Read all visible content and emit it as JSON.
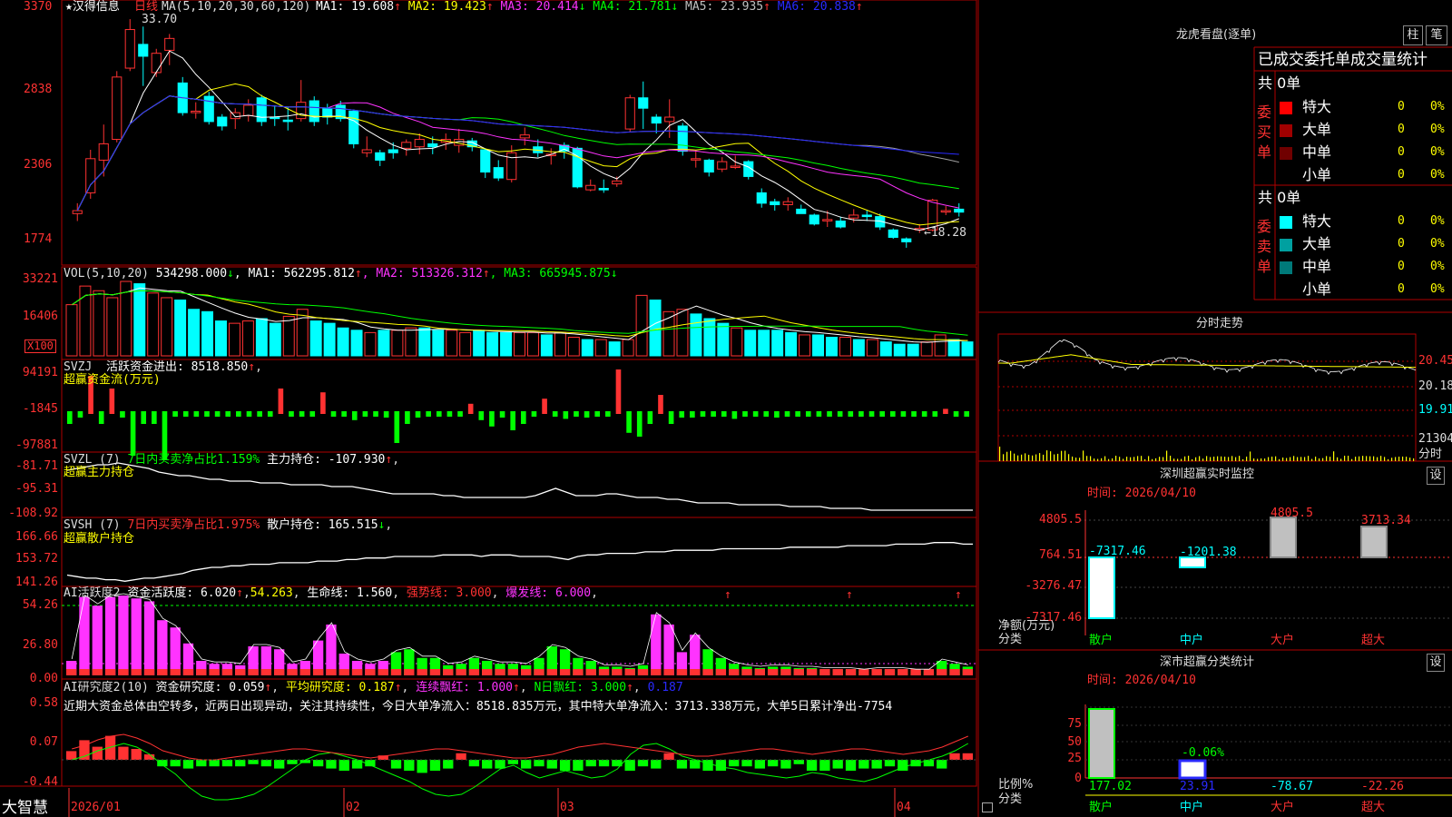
{
  "stock_name": "汉得信息",
  "period_label": "日线",
  "brand": "大智慧",
  "colors": {
    "up": "#ff3232",
    "down": "#00ffff",
    "ma1": "#ffffff",
    "ma2": "#ffff00",
    "ma3": "#ff33ff",
    "ma4": "#00ff00",
    "ma5": "#a0a0a0",
    "ma6": "#2a2aff",
    "grid": "#b00000"
  },
  "main_panel": {
    "ma_title": "MA(5,10,20,30,60,120)",
    "ma_items": [
      {
        "label": "MA1: 19.608",
        "arrow": "↑",
        "color": "#ffffff"
      },
      {
        "label": "MA2: 19.423",
        "arrow": "↑",
        "color": "#ffff00"
      },
      {
        "label": "MA3: 20.414",
        "arrow": "↓",
        "color": "#ff33ff"
      },
      {
        "label": "MA4: 21.781",
        "arrow": "↓",
        "color": "#00ff00"
      },
      {
        "label": "MA5: 23.935",
        "arrow": "↑",
        "color": "#c0c0c0"
      },
      {
        "label": "MA6: 20.838",
        "arrow": "↑",
        "color": "#2a2aff"
      }
    ],
    "y_ticks": [
      "3370",
      "2838",
      "2306",
      "1774"
    ],
    "high_label": "33.70",
    "low_label": "←18.28",
    "candles": [
      {
        "o": 20.6,
        "c": 20.8,
        "h": 21.3,
        "l": 20.1
      },
      {
        "o": 22.0,
        "c": 24.3,
        "h": 24.9,
        "l": 21.6
      },
      {
        "o": 24.2,
        "c": 25.3,
        "h": 26.6,
        "l": 23.1
      },
      {
        "o": 25.6,
        "c": 29.8,
        "h": 30.2,
        "l": 25.4
      },
      {
        "o": 30.4,
        "c": 33.0,
        "h": 33.7,
        "l": 30.2
      },
      {
        "o": 32.0,
        "c": 31.2,
        "h": 33.2,
        "l": 29.2
      },
      {
        "o": 30.1,
        "c": 31.4,
        "h": 31.7,
        "l": 29.8
      },
      {
        "o": 31.6,
        "c": 32.4,
        "h": 32.7,
        "l": 30.6
      },
      {
        "o": 29.4,
        "c": 27.4,
        "h": 29.8,
        "l": 27.2
      },
      {
        "o": 27.4,
        "c": 27.5,
        "h": 28.1,
        "l": 27.0
      },
      {
        "o": 28.5,
        "c": 26.8,
        "h": 28.8,
        "l": 26.6
      },
      {
        "o": 27.1,
        "c": 26.5,
        "h": 27.3,
        "l": 26.2
      },
      {
        "o": 27.0,
        "c": 27.4,
        "h": 27.7,
        "l": 26.3
      },
      {
        "o": 27.2,
        "c": 27.9,
        "h": 28.3,
        "l": 26.8
      },
      {
        "o": 28.4,
        "c": 26.8,
        "h": 28.6,
        "l": 26.5
      },
      {
        "o": 27.1,
        "c": 27.0,
        "h": 27.9,
        "l": 26.5
      },
      {
        "o": 26.9,
        "c": 26.8,
        "h": 27.8,
        "l": 26.2
      },
      {
        "o": 27.0,
        "c": 28.1,
        "h": 29.6,
        "l": 26.8
      },
      {
        "o": 28.2,
        "c": 26.8,
        "h": 28.5,
        "l": 26.5
      },
      {
        "o": 27.7,
        "c": 27.1,
        "h": 28.0,
        "l": 26.6
      },
      {
        "o": 27.9,
        "c": 27.0,
        "h": 28.2,
        "l": 26.8
      },
      {
        "o": 27.5,
        "c": 25.3,
        "h": 27.6,
        "l": 25.0
      },
      {
        "o": 24.7,
        "c": 24.9,
        "h": 25.8,
        "l": 24.4
      },
      {
        "o": 24.7,
        "c": 24.2,
        "h": 24.9,
        "l": 23.8
      },
      {
        "o": 24.9,
        "c": 24.7,
        "h": 25.4,
        "l": 24.3
      },
      {
        "o": 25.0,
        "c": 25.4,
        "h": 25.6,
        "l": 24.5
      },
      {
        "o": 25.1,
        "c": 25.6,
        "h": 26.0,
        "l": 24.6
      },
      {
        "o": 25.3,
        "c": 25.1,
        "h": 25.8,
        "l": 24.6
      },
      {
        "o": 25.4,
        "c": 25.6,
        "h": 26.0,
        "l": 24.9
      },
      {
        "o": 25.2,
        "c": 25.6,
        "h": 26.3,
        "l": 24.7
      },
      {
        "o": 25.5,
        "c": 25.1,
        "h": 25.7,
        "l": 24.8
      },
      {
        "o": 24.9,
        "c": 23.4,
        "h": 25.0,
        "l": 23.0
      },
      {
        "o": 23.7,
        "c": 23.0,
        "h": 24.2,
        "l": 22.8
      },
      {
        "o": 22.9,
        "c": 24.7,
        "h": 25.2,
        "l": 22.7
      },
      {
        "o": 25.7,
        "c": 25.9,
        "h": 26.4,
        "l": 25.2
      },
      {
        "o": 25.1,
        "c": 24.7,
        "h": 25.6,
        "l": 24.4
      },
      {
        "o": 24.5,
        "c": 24.6,
        "h": 25.0,
        "l": 23.9
      },
      {
        "o": 25.2,
        "c": 24.8,
        "h": 25.4,
        "l": 24.3
      },
      {
        "o": 25.0,
        "c": 22.4,
        "h": 25.1,
        "l": 22.3
      },
      {
        "o": 22.2,
        "c": 22.5,
        "h": 22.9,
        "l": 22.1
      },
      {
        "o": 22.3,
        "c": 22.2,
        "h": 22.9,
        "l": 22.0
      },
      {
        "o": 22.6,
        "c": 22.8,
        "h": 23.1,
        "l": 22.4
      },
      {
        "o": 26.3,
        "c": 28.4,
        "h": 28.6,
        "l": 26.1
      },
      {
        "o": 28.4,
        "c": 27.7,
        "h": 29.5,
        "l": 26.3
      },
      {
        "o": 27.1,
        "c": 26.7,
        "h": 27.3,
        "l": 26.0
      },
      {
        "o": 26.8,
        "c": 27.1,
        "h": 28.3,
        "l": 25.7
      },
      {
        "o": 26.5,
        "c": 24.8,
        "h": 26.7,
        "l": 24.5
      },
      {
        "o": 24.3,
        "c": 24.3,
        "h": 24.9,
        "l": 23.7
      },
      {
        "o": 24.2,
        "c": 23.4,
        "h": 24.3,
        "l": 23.1
      },
      {
        "o": 23.6,
        "c": 24.1,
        "h": 24.4,
        "l": 23.4
      },
      {
        "o": 23.8,
        "c": 23.8,
        "h": 24.5,
        "l": 23.6
      },
      {
        "o": 24.1,
        "c": 23.1,
        "h": 24.2,
        "l": 22.9
      },
      {
        "o": 22.0,
        "c": 21.3,
        "h": 22.3,
        "l": 21.0
      },
      {
        "o": 21.4,
        "c": 21.2,
        "h": 21.6,
        "l": 20.8
      },
      {
        "o": 21.2,
        "c": 21.4,
        "h": 21.7,
        "l": 20.8
      },
      {
        "o": 20.9,
        "c": 20.6,
        "h": 21.2,
        "l": 20.6
      },
      {
        "o": 20.5,
        "c": 19.9,
        "h": 20.6,
        "l": 19.8
      },
      {
        "o": 20.2,
        "c": 20.2,
        "h": 20.8,
        "l": 19.7
      },
      {
        "o": 20.1,
        "c": 19.7,
        "h": 20.4,
        "l": 19.6
      },
      {
        "o": 20.3,
        "c": 20.5,
        "h": 20.9,
        "l": 20.0
      },
      {
        "o": 20.5,
        "c": 20.4,
        "h": 20.8,
        "l": 20.1
      },
      {
        "o": 20.4,
        "c": 19.7,
        "h": 20.6,
        "l": 19.5
      },
      {
        "o": 19.5,
        "c": 19.0,
        "h": 19.6,
        "l": 18.9
      },
      {
        "o": 18.9,
        "c": 18.7,
        "h": 19.0,
        "l": 18.3
      },
      {
        "o": 19.5,
        "c": 19.6,
        "h": 19.9,
        "l": 19.3
      },
      {
        "o": 19.5,
        "c": 21.5,
        "h": 21.6,
        "l": 19.4
      },
      {
        "o": 20.8,
        "c": 20.8,
        "h": 21.1,
        "l": 20.5
      },
      {
        "o": 20.9,
        "c": 20.7,
        "h": 21.3,
        "l": 20.4
      }
    ]
  },
  "vol_panel": {
    "title": "VOL(5,10,20)",
    "value": "534298.000",
    "value_arrow": "↓",
    "items": [
      {
        "label": "MA1: 562295.812",
        "arrow": "↑",
        "color": "#ffffff"
      },
      {
        "label": "MA2: 513326.312",
        "arrow": "↑",
        "color": "#ff33ff"
      },
      {
        "label": "MA3: 665945.875",
        "arrow": "↓",
        "color": "#00ff00"
      }
    ],
    "y_ticks": [
      "33221",
      "16406"
    ],
    "unit": "X100",
    "bars": [
      22,
      30,
      28,
      25,
      32,
      31,
      27,
      25,
      24,
      20,
      19,
      15,
      14,
      15,
      16,
      14,
      17,
      20,
      15,
      14,
      12,
      11,
      10,
      11,
      11,
      12,
      12,
      11,
      11,
      10,
      11,
      10,
      10,
      10,
      10,
      9,
      10,
      8,
      7,
      7,
      6,
      7,
      26,
      24,
      19,
      20,
      18,
      16,
      14,
      12,
      11,
      11,
      11,
      10,
      9,
      9,
      8,
      8,
      7,
      7,
      6,
      5,
      5,
      6,
      9,
      7,
      6
    ],
    "up": [
      1,
      1,
      1,
      1,
      1,
      0,
      1,
      1,
      0,
      0,
      0,
      0,
      1,
      1,
      0,
      0,
      1,
      1,
      0,
      0,
      0,
      0,
      1,
      0,
      1,
      1,
      0,
      0,
      1,
      1,
      0,
      0,
      0,
      1,
      1,
      0,
      1,
      1,
      0,
      1,
      0,
      1,
      1,
      0,
      1,
      1,
      0,
      0,
      0,
      1,
      0,
      0,
      0,
      0,
      1,
      0,
      0,
      1,
      0,
      1,
      0,
      0,
      0,
      1,
      1,
      0,
      0
    ]
  },
  "svzj_panel": {
    "title": "SVZJ",
    "label": "活跃资金进出: 8518.850",
    "arrow": "↑",
    "sub": "超赢资金流(万元)",
    "y_ticks": [
      "94191",
      "-1845",
      "-97881"
    ],
    "bars": [
      -10,
      -5,
      30,
      -10,
      20,
      -5,
      -35,
      -10,
      -10,
      -38,
      -4,
      -3,
      -2,
      -2,
      -3,
      0,
      -4,
      -3,
      -3,
      -2,
      20,
      -3,
      -2,
      0,
      17,
      -2,
      -3,
      -7,
      -2,
      -3,
      -5,
      -25,
      -10,
      -5,
      -3,
      -2,
      -3,
      0,
      8,
      -7,
      -12,
      -5,
      -15,
      -10,
      0,
      12,
      -3,
      -6,
      -3,
      -5,
      -2,
      -3,
      35,
      -17,
      -20,
      -10,
      15,
      -10,
      -5,
      -5,
      -2,
      -4,
      -3,
      -6,
      -4,
      -3,
      -4,
      -5,
      -3,
      -2,
      -3,
      -2,
      -4,
      -3,
      -2,
      -2,
      -2,
      -2,
      -2,
      -4,
      -3,
      -3,
      -2,
      4,
      -2,
      -2
    ]
  },
  "svzl_panel": {
    "title": "SVZL (7)",
    "green_label": "7日内买卖净占比1.159%",
    "label": "主力持仓: -107.930",
    "arrow": "↑",
    "sub": "超赢主力持仓",
    "y_ticks": [
      "-81.71",
      "-95.31",
      "-108.92"
    ],
    "line": [
      -86,
      -85,
      -84,
      -83,
      -83,
      -82,
      -83,
      -84,
      -85,
      -87,
      -88,
      -89,
      -89,
      -90,
      -91,
      -91,
      -92,
      -92,
      -92,
      -93,
      -93,
      -93,
      -94,
      -94,
      -94,
      -94,
      -95,
      -95,
      -95,
      -96,
      -97,
      -98,
      -99,
      -99,
      -99,
      -99,
      -99,
      -100,
      -100,
      -101,
      -101,
      -101,
      -101,
      -101,
      -101,
      -101,
      -100,
      -98,
      -96,
      -98,
      -100,
      -100,
      -100,
      -99,
      -99,
      -100,
      -101,
      -101,
      -101,
      -102,
      -102,
      -103,
      -104,
      -104,
      -104,
      -104,
      -105,
      -105,
      -105,
      -105,
      -105,
      -106,
      -106,
      -106,
      -106,
      -107,
      -107,
      -107,
      -107,
      -108,
      -108,
      -108,
      -108,
      -108,
      -108,
      -108,
      -108,
      -108,
      -108,
      -108
    ]
  },
  "svsh_panel": {
    "title": "SVSH (7)",
    "red_label": "7日内买卖净占比1.975%",
    "label": "散户持仓: 165.515",
    "arrow": "↓",
    "sub": "超赢散户持仓",
    "y_ticks": [
      "166.66",
      "153.72",
      "141.26"
    ],
    "line": [
      145,
      144,
      143,
      143,
      142,
      142,
      141,
      142,
      143,
      143,
      144,
      145,
      146,
      148,
      149,
      150,
      150,
      151,
      151,
      152,
      152,
      152,
      153,
      153,
      153,
      153,
      154,
      154,
      154,
      155,
      155,
      156,
      156,
      156,
      157,
      157,
      157,
      157,
      157,
      158,
      158,
      158,
      158,
      157,
      158,
      158,
      158,
      157,
      157,
      157,
      157,
      156,
      155,
      157,
      158,
      158,
      159,
      159,
      159,
      159,
      160,
      160,
      160,
      161,
      161,
      161,
      161,
      161,
      162,
      162,
      162,
      162,
      162,
      162,
      162,
      163,
      163,
      163,
      163,
      163,
      163,
      164,
      164,
      164,
      164,
      164,
      165,
      165,
      165,
      165,
      166,
      166,
      166,
      165,
      165
    ]
  },
  "ai_hy_panel": {
    "title": "AI活跃度2",
    "label": "资金活跃度: 6.020",
    "arrow": "↑",
    "val2": "54.263",
    "life_label": "生命线: 1.560",
    "strong_label": "强势线: 3.000",
    "burst_label": "爆发线: 6.000",
    "y_ticks": [
      "54.26",
      "26.80",
      "0.00"
    ],
    "bars": [
      10,
      54,
      48,
      54,
      55,
      53,
      51,
      38,
      33,
      22,
      10,
      8,
      8,
      7,
      20,
      20,
      18,
      8,
      10,
      24,
      35,
      15,
      10,
      8,
      10,
      16,
      18,
      12,
      12,
      7,
      8,
      12,
      10,
      8,
      8,
      7,
      12,
      20,
      18,
      12,
      10,
      6,
      6,
      5,
      7,
      42,
      35,
      16,
      28,
      18,
      12,
      8,
      6,
      5,
      6,
      6,
      5,
      5,
      4,
      4,
      4,
      3,
      4,
      4,
      4,
      3,
      3,
      10,
      8,
      6
    ],
    "colors": [
      1,
      1,
      1,
      1,
      1,
      1,
      1,
      1,
      1,
      1,
      1,
      1,
      1,
      1,
      1,
      1,
      1,
      1,
      1,
      1,
      1,
      1,
      1,
      1,
      1,
      0,
      0,
      0,
      0,
      0,
      0,
      0,
      0,
      0,
      0,
      0,
      0,
      0,
      0,
      0,
      0,
      0,
      0,
      0,
      0,
      1,
      1,
      1,
      1,
      0,
      0,
      0,
      0,
      0,
      0,
      0,
      0,
      0,
      0,
      0,
      0,
      0,
      0,
      0,
      0,
      0,
      0,
      0,
      0,
      0
    ],
    "arrows": [
      "↑",
      "↑",
      "↑"
    ]
  },
  "ai_yj_panel": {
    "title": "AI研究度2(10)",
    "label": "资金研究度: 0.059",
    "arrow": "↑",
    "avg_label": "平均研究度: 0.187",
    "avg_arrow": "↑",
    "lx_label": "连续飘红: 1.000",
    "lx_arrow": "↑",
    "n_label": "N日飘红: 3.000",
    "n_arrow": "↑",
    "last_val": "0.187",
    "y_ticks": [
      "0.58",
      "0.07",
      "-0.44"
    ],
    "comment": "近期大资金总体由空转多，近两日出现异动，关注其持续性，今日大单净流入：8518.835万元，其中特大单净流入：3713.338万元，大单5日累计净出-7754",
    "bars": [
      8,
      18,
      12,
      22,
      12,
      10,
      5,
      -6,
      -6,
      -8,
      -6,
      -6,
      -6,
      -6,
      -4,
      -6,
      -8,
      -4,
      -3,
      -6,
      -8,
      -10,
      -8,
      -6,
      4,
      -8,
      -10,
      -12,
      -10,
      -8,
      6,
      -6,
      -8,
      -8,
      -4,
      -8,
      -6,
      -8,
      -10,
      -10,
      -6,
      -6,
      -6,
      -10,
      -6,
      -8,
      6,
      -8,
      -8,
      -10,
      -10,
      -6,
      -6,
      -8,
      -6,
      -8,
      -4,
      -10,
      -10,
      -8,
      -10,
      -8,
      -8,
      -6,
      -10,
      -6,
      -6,
      -8,
      6,
      6
    ]
  },
  "x_axis": [
    "2026/01",
    "02",
    "03",
    "04"
  ],
  "right": {
    "lhb_title": "龙虎看盘(逐单)",
    "btn_zhu": "柱",
    "btn_bi": "笔",
    "tj_title": "已成交委托单成交量统计",
    "buy_group": {
      "label": "委买单",
      "count": "共 0单",
      "rows": [
        {
          "name": "特大",
          "val": "0",
          "pct": "0%",
          "color": "#ff0000"
        },
        {
          "name": "大单",
          "val": "0",
          "pct": "0%",
          "color": "#a00000"
        },
        {
          "name": "中单",
          "val": "0",
          "pct": "0%",
          "color": "#700000"
        },
        {
          "name": "小单",
          "val": "0",
          "pct": "0%",
          "color": ""
        }
      ]
    },
    "sell_group": {
      "label": "委卖单",
      "count": "共 0单",
      "rows": [
        {
          "name": "特大",
          "val": "0",
          "pct": "0%",
          "color": "#00ffff"
        },
        {
          "name": "大单",
          "val": "0",
          "pct": "0%",
          "color": "#00a0a0"
        },
        {
          "name": "中单",
          "val": "0",
          "pct": "0%",
          "color": "#007a7a"
        },
        {
          "name": "小单",
          "val": "0",
          "pct": "0%",
          "color": ""
        }
      ]
    },
    "fs_title": "分时走势",
    "fs_ticks": [
      "20.45",
      "20.18",
      "19.91",
      "21304",
      "分时"
    ],
    "sz_title": "深圳超赢实时监控",
    "sz_btn": "设",
    "sz_time": "时间: 2026/04/10",
    "sz_ticks": [
      "4805.5",
      "764.51",
      "-3276.47",
      "-7317.46"
    ],
    "sz_unit": "净额(万元)",
    "sz_cat_label": "分类",
    "sz_cats": [
      "散户",
      "中户",
      "大户",
      "超大"
    ],
    "sz_values": [
      -7317.46,
      -1201.38,
      4805.5,
      3713.34
    ],
    "sz_value_labels": [
      "-7317.46",
      "-1201.38",
      "4805.5",
      "3713.34"
    ],
    "fl_title": "深市超赢分类统计",
    "fl_btn": "设",
    "fl_time": "时间: 2026/04/10",
    "fl_ticks": [
      "75",
      "50",
      "25",
      "0"
    ],
    "fl_pct_label": "-0.06%",
    "fl_ratio_label": "比例%",
    "fl_cat_label": "分类",
    "fl_bottom": [
      "177.02",
      "23.91",
      "-78.67",
      "-22.26"
    ],
    "fl_cats": [
      "散户",
      "中户",
      "大户",
      "超大"
    ]
  }
}
